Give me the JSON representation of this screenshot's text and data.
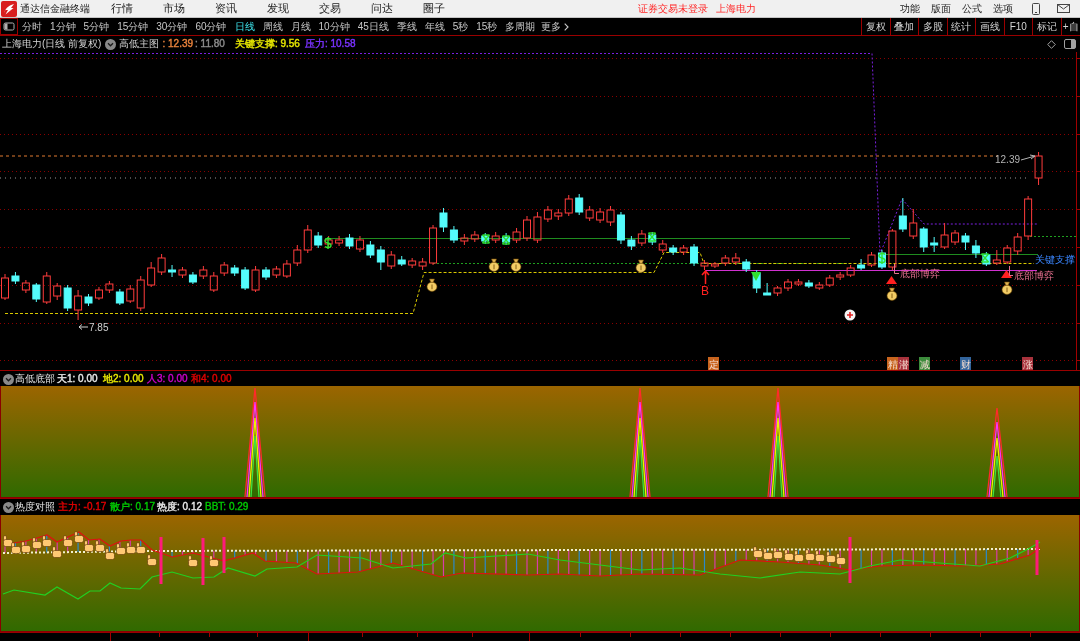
{
  "app_bar": {
    "title": "通达信金融终端",
    "menu": [
      "行情",
      "市场",
      "资讯",
      "发现",
      "交易",
      "问达",
      "圈子"
    ],
    "login_notice": "证券交易未登录",
    "stock_link": "上海电力",
    "tools": [
      "功能",
      "版面",
      "公式",
      "选项"
    ]
  },
  "period_bar": {
    "periods": [
      {
        "label": "分时",
        "selected": false
      },
      {
        "label": "1分钟",
        "selected": false
      },
      {
        "label": "5分钟",
        "selected": false
      },
      {
        "label": "15分钟",
        "selected": false
      },
      {
        "label": "30分钟",
        "selected": false
      },
      {
        "label": "60分钟",
        "selected": false
      },
      {
        "label": "日线",
        "selected": true
      },
      {
        "label": "周线",
        "selected": false
      },
      {
        "label": "月线",
        "selected": false
      },
      {
        "label": "10分钟",
        "selected": false
      },
      {
        "label": "45日线",
        "selected": false
      },
      {
        "label": "季线",
        "selected": false
      },
      {
        "label": "年线",
        "selected": false
      },
      {
        "label": "5秒",
        "selected": false
      },
      {
        "label": "15秒",
        "selected": false
      },
      {
        "label": "多周期",
        "selected": false
      }
    ],
    "more": "更多",
    "buttons": [
      "复权",
      "叠加",
      "多股",
      "统计",
      "画线",
      "F10",
      "标记",
      "+自"
    ]
  },
  "main_chart": {
    "title": "上海电力(日线 前复权)",
    "indicator": "高低主图",
    "readings": [
      {
        "text": ": 12.39",
        "color": "#e8823c"
      },
      {
        "text": ": 11.80",
        "color": "#8c8c8c"
      },
      {
        "text": "关键支撑: 9.56",
        "color": "#e6e600"
      },
      {
        "text": "压力: 10.58",
        "color": "#7a32ff"
      }
    ],
    "high_label": "12.39",
    "low_label": "7.85",
    "buy_signal": "B",
    "bottom_signals": [
      "底部博弈",
      "底部博弈"
    ],
    "support_label": "关键支撑",
    "tags": [
      {
        "text": "定",
        "color": "#c8641e"
      },
      {
        "text": "精",
        "color": "#c8641e"
      },
      {
        "text": "潜",
        "color": "#a8323c"
      },
      {
        "text": "减",
        "color": "#3c8c3c"
      },
      {
        "text": "财",
        "color": "#32649c"
      },
      {
        "text": "涨",
        "color": "#a8323c"
      }
    ]
  },
  "signal_panel": {
    "name": "高低底部",
    "readings": [
      {
        "text": "天1: 0.00",
        "color": "#e6e6e6"
      },
      {
        "text": "地2: 0.00",
        "color": "#e6e600"
      },
      {
        "text": "人3: 0.00",
        "color": "#c800c8"
      },
      {
        "text": "和4: 0.00",
        "color": "#e00000"
      }
    ]
  },
  "heat_panel": {
    "name": "热度对照",
    "readings": [
      {
        "text": "主力: -0.17",
        "color": "#e00000"
      },
      {
        "text": "散户: 0.17",
        "color": "#00c800"
      },
      {
        "text": "热度: 0.12",
        "color": "#e6e6e6"
      },
      {
        "text": "BBT: 0.29",
        "color": "#00c800"
      }
    ]
  }
}
